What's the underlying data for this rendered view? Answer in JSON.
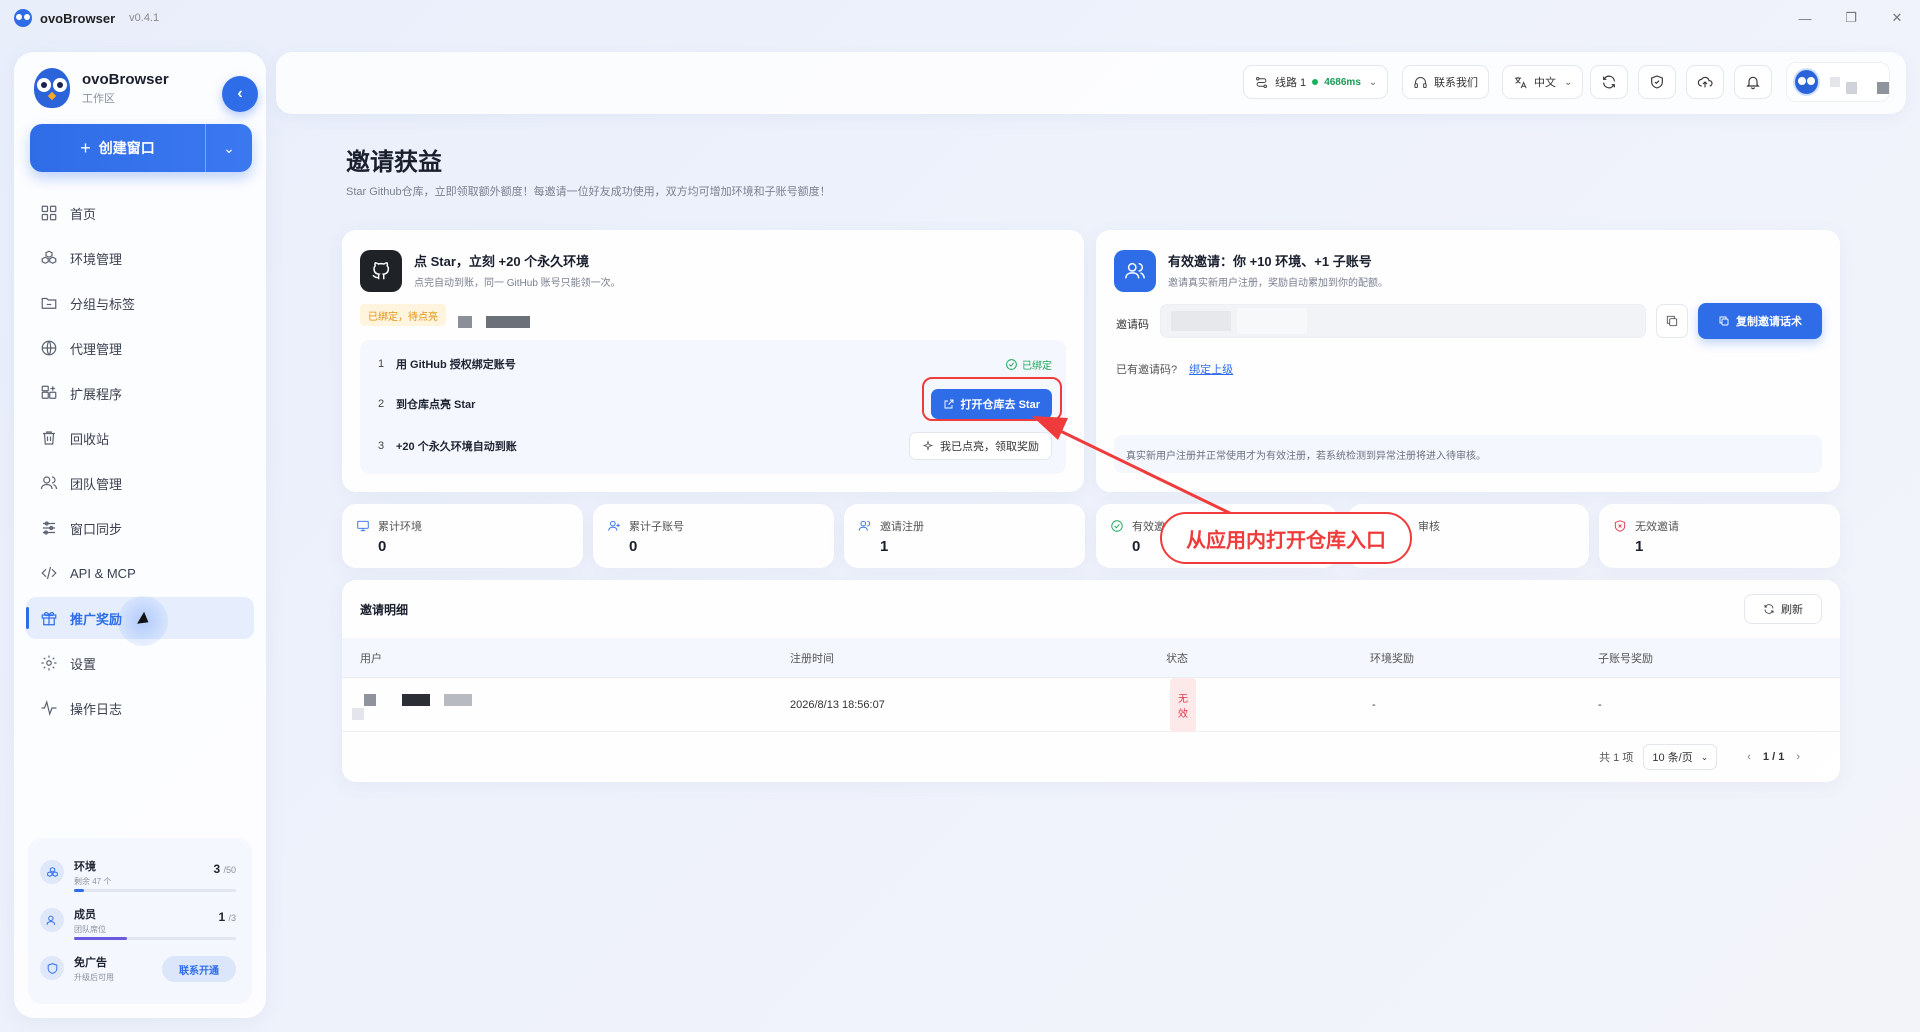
{
  "app": {
    "name": "ovoBrowser",
    "version": "v0.4.1"
  },
  "sidebar": {
    "brand_title": "ovoBrowser",
    "brand_sub": "工作区",
    "create_label": "创建窗口",
    "items": [
      {
        "label": "首页",
        "icon": "grid-icon"
      },
      {
        "label": "环境管理",
        "icon": "cubes-icon"
      },
      {
        "label": "分组与标签",
        "icon": "folder-icon"
      },
      {
        "label": "代理管理",
        "icon": "globe-icon"
      },
      {
        "label": "扩展程序",
        "icon": "extension-icon"
      },
      {
        "label": "回收站",
        "icon": "trash-icon"
      },
      {
        "label": "团队管理",
        "icon": "users-icon"
      },
      {
        "label": "窗口同步",
        "icon": "sliders-icon"
      },
      {
        "label": "API & MCP",
        "icon": "code-icon"
      },
      {
        "label": "推广奖励",
        "icon": "gift-icon",
        "active": true
      },
      {
        "label": "设置",
        "icon": "gear-icon"
      },
      {
        "label": "操作日志",
        "icon": "activity-icon"
      }
    ],
    "quota": {
      "env": {
        "title": "环境",
        "sub": "剩余 47 个",
        "value": "3",
        "total": "/50",
        "fraction": 0.06
      },
      "member": {
        "title": "成员",
        "sub": "团队席位",
        "value": "1",
        "total": "/3",
        "fraction": 0.33
      },
      "ads": {
        "title": "免广告",
        "sub": "升级后可用",
        "button": "联系开通"
      }
    }
  },
  "topbar": {
    "line_label": "线路 1",
    "latency": "4686ms",
    "contact": "联系我们",
    "lang": "中文"
  },
  "page": {
    "title": "邀请获益",
    "subtitle": "Star Github仓库，立即领取额外额度！每邀请一位好友成功使用，双方均可增加环境和子账号额度！"
  },
  "star_card": {
    "title": "点 Star，立刻 +20 个永久环境",
    "subtitle": "点完自动到账，同一 GitHub 账号只能领一次。",
    "tag": "已绑定，待点亮",
    "steps": [
      {
        "num": "1",
        "text": "用 GitHub 授权绑定账号",
        "status": "已绑定"
      },
      {
        "num": "2",
        "text": "到仓库点亮 Star",
        "button": "打开仓库去 Star"
      },
      {
        "num": "3",
        "text": "+20 个永久环境自动到账",
        "button": "我已点亮，领取奖励"
      }
    ]
  },
  "invite_card": {
    "title": "有效邀请：你 +10 环境、+1 子账号",
    "subtitle": "邀请真实新用户注册，奖励自动累加到你的配额。",
    "code_label": "邀请码",
    "copy_button": "复制邀请话术",
    "have_code": "已有邀请码?",
    "bind_link": "绑定上级",
    "notice": "真实新用户注册并正常使用才为有效注册，若系统检测到异常注册将进入待审核。"
  },
  "stats": [
    {
      "label": "累计环境",
      "value": "0",
      "icon": "monitor-icon"
    },
    {
      "label": "累计子账号",
      "value": "0",
      "icon": "user-plus-icon"
    },
    {
      "label": "邀请注册",
      "value": "1",
      "icon": "users-icon"
    },
    {
      "label": "有效邀",
      "value": "0",
      "icon": "check-circle-icon"
    },
    {
      "label": "审核",
      "value": "",
      "icon": "clock-icon"
    },
    {
      "label": "无效邀请",
      "value": "1",
      "icon": "shield-x-icon"
    }
  ],
  "annotation": {
    "text": "从应用内打开仓库入口",
    "color": "#ef3b3b"
  },
  "table": {
    "title": "邀请明细",
    "refresh": "刷新",
    "columns": [
      "用户",
      "注册时间",
      "状态",
      "环境奖励",
      "子账号奖励"
    ],
    "rows": [
      {
        "time": "2026/8/13 18:56:07",
        "status": "无效",
        "env_reward": "-",
        "sub_reward": "-"
      }
    ],
    "total": "共 1 项",
    "page_size": "10 条/页",
    "page": "1 / 1"
  },
  "colors": {
    "accent": "#2f6de8",
    "success": "#1aa85a",
    "danger": "#e0394c",
    "warning": "#e29110"
  }
}
